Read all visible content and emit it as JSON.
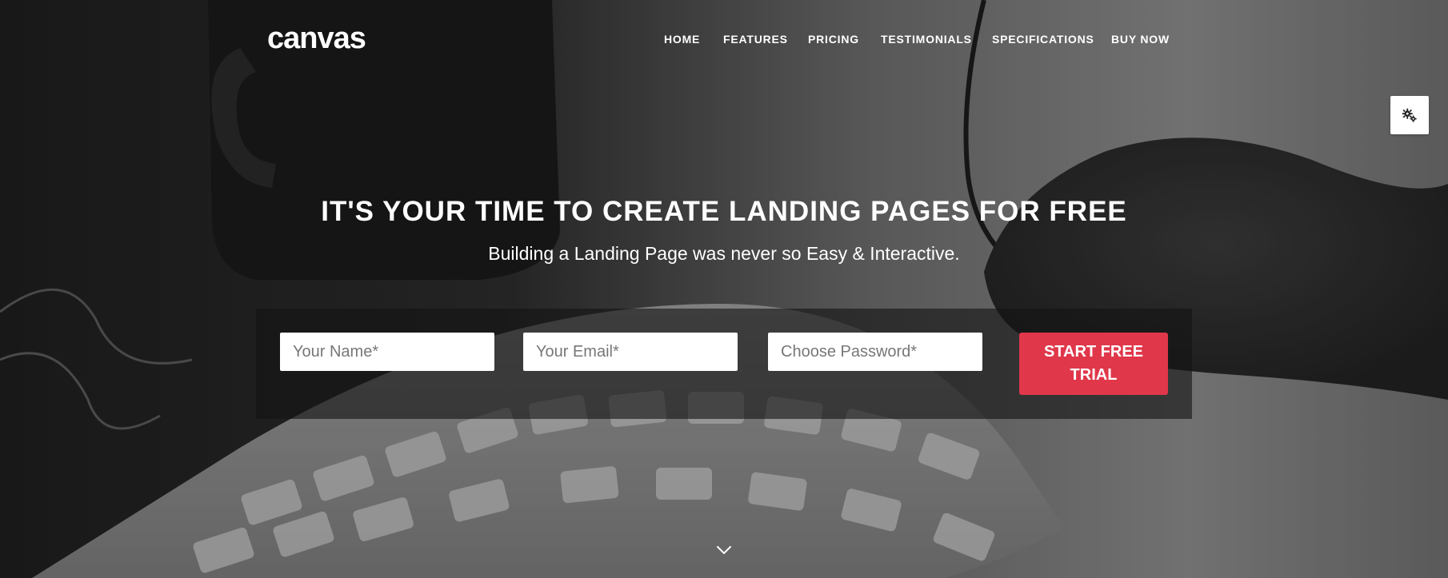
{
  "brand": {
    "logo_text": "canvas"
  },
  "nav": {
    "items": [
      {
        "label": "HOME"
      },
      {
        "label": "FEATURES"
      },
      {
        "label": "PRICING"
      },
      {
        "label": "TESTIMONIALS"
      },
      {
        "label": "SPECIFICATIONS"
      },
      {
        "label": "BUY NOW"
      }
    ]
  },
  "hero": {
    "headline": "IT'S YOUR TIME TO CREATE LANDING PAGES FOR FREE",
    "subheadline": "Building a Landing Page was never so Easy & Interactive."
  },
  "signup_form": {
    "name_placeholder": "Your Name*",
    "email_placeholder": "Your Email*",
    "password_placeholder": "Choose Password*",
    "submit_label": "START FREE TRIAL"
  },
  "icons": {
    "settings": "gears-icon",
    "scroll": "chevron-down-icon"
  },
  "colors": {
    "accent": "#e0374a",
    "text": "#ffffff",
    "panel": "#141414"
  }
}
